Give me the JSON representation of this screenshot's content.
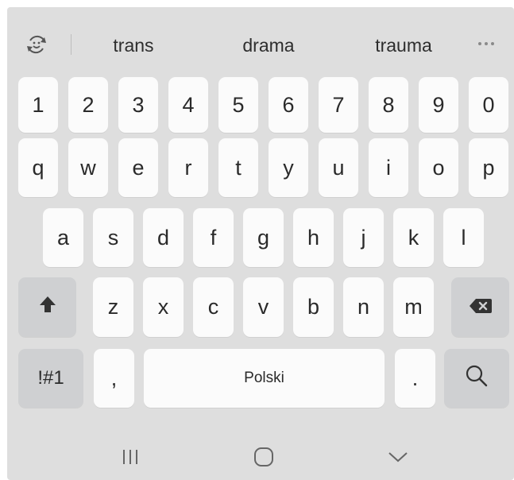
{
  "suggestions": [
    "trans",
    "drama",
    "trauma"
  ],
  "icons": {
    "emoji": "emoji-sticker-icon",
    "more": "more-options-icon",
    "shift": "shift-arrow-icon",
    "backspace": "backspace-icon",
    "search": "search-icon",
    "recents": "recent-apps-icon",
    "home": "home-icon",
    "hide": "hide-keyboard-chevron-icon"
  },
  "keyboard": {
    "row_numbers": [
      "1",
      "2",
      "3",
      "4",
      "5",
      "6",
      "7",
      "8",
      "9",
      "0"
    ],
    "row_top": [
      "q",
      "w",
      "e",
      "r",
      "t",
      "y",
      "u",
      "i",
      "o",
      "p"
    ],
    "row_home": [
      "a",
      "s",
      "d",
      "f",
      "g",
      "h",
      "j",
      "k",
      "l"
    ],
    "row_bottom": [
      "z",
      "x",
      "c",
      "v",
      "b",
      "n",
      "m"
    ],
    "symbols_label": "!#1",
    "comma": ",",
    "space_label": "Polski",
    "period": "."
  },
  "colors": {
    "background": "#dedede",
    "key": "#fbfbfb",
    "function_key": "#cfd0d2",
    "text": "#2a2a2a"
  }
}
